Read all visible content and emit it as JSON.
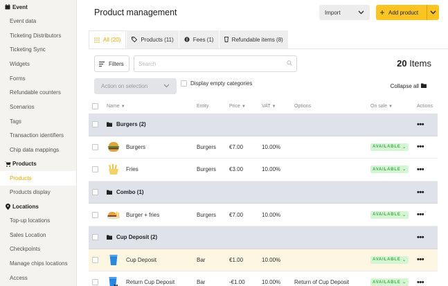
{
  "sidebar": {
    "groups": [
      {
        "title": "Event",
        "icon": "calendar-icon",
        "items": [
          "Event data",
          "Ticketing Distributors",
          "Ticketing Sync",
          "Widgets",
          "Forms",
          "Refundable counters",
          "Scenarios",
          "Tags",
          "Transaction identifiers",
          "Chip data mappings"
        ]
      },
      {
        "title": "Products",
        "icon": "cart-icon",
        "items": [
          "Products",
          "Products display"
        ],
        "active": "Products"
      },
      {
        "title": "Locations",
        "icon": "location-pin-icon",
        "items": [
          "Top-up locations",
          "Sales Location",
          "Checkpoints",
          "Manage chips locations",
          "Access"
        ]
      }
    ]
  },
  "header": {
    "title": "Product management",
    "import_label": "Import",
    "add_label": "Add product"
  },
  "tabs": [
    {
      "label": "All (20)",
      "icon": "grid-icon",
      "active": true
    },
    {
      "label": "Products (11)",
      "icon": "tag-icon"
    },
    {
      "label": "Fees (1)",
      "icon": "coin-icon"
    },
    {
      "label": "Refundable items (8)",
      "icon": "cup-icon"
    }
  ],
  "toolbar": {
    "filters_label": "Filters",
    "search_placeholder": "Search",
    "count_number": "20",
    "count_label": "Items",
    "action_label": "Action on selection",
    "display_empty_label": "Display empty categories",
    "collapse_label": "Collapse all"
  },
  "table": {
    "headers": {
      "name": "Name",
      "entity": "Entity",
      "price": "Price",
      "vat": "VAT",
      "options": "Options",
      "on_sale": "On sale",
      "actions": "Actions"
    },
    "rows": [
      {
        "type": "group",
        "name": "Burgers (2)"
      },
      {
        "type": "item",
        "name": "Burgers",
        "thumb": "burger-icon",
        "entity": "Burgers",
        "price": "€7.00",
        "vat": "10.00%",
        "options": "",
        "status": "AVAILABLE"
      },
      {
        "type": "item",
        "name": "Fries",
        "thumb": "fries-icon",
        "entity": "Burgers",
        "price": "€3.00",
        "vat": "10.00%",
        "options": "",
        "status": "AVAILABLE"
      },
      {
        "type": "group",
        "name": "Combo (1)"
      },
      {
        "type": "item",
        "name": "Burger + fries",
        "thumb": "combo-icon",
        "entity": "Burgers",
        "price": "€7.00",
        "vat": "10.00%",
        "options": "",
        "status": "AVAILABLE"
      },
      {
        "type": "group",
        "name": "Cup Deposit (2)"
      },
      {
        "type": "item",
        "name": "Cup Deposit",
        "thumb": "cup-icon",
        "entity": "Bar",
        "price": "€1.00",
        "vat": "10.00%",
        "options": "",
        "status": "AVAILABLE",
        "highlight": true
      },
      {
        "type": "item",
        "name": "Return Cup Deposit",
        "thumb": "return-cup-icon",
        "entity": "Bar",
        "price": "-€1.00",
        "vat": "10.00%",
        "options": "Return of Cup Deposit",
        "status": "AVAILABLE"
      }
    ]
  },
  "colors": {
    "accent": "#fbc423",
    "accent_text": "#e2a800",
    "group_row": "#e0e2ea",
    "available_bg": "#d6f5d2",
    "available_text": "#3bb34a"
  }
}
